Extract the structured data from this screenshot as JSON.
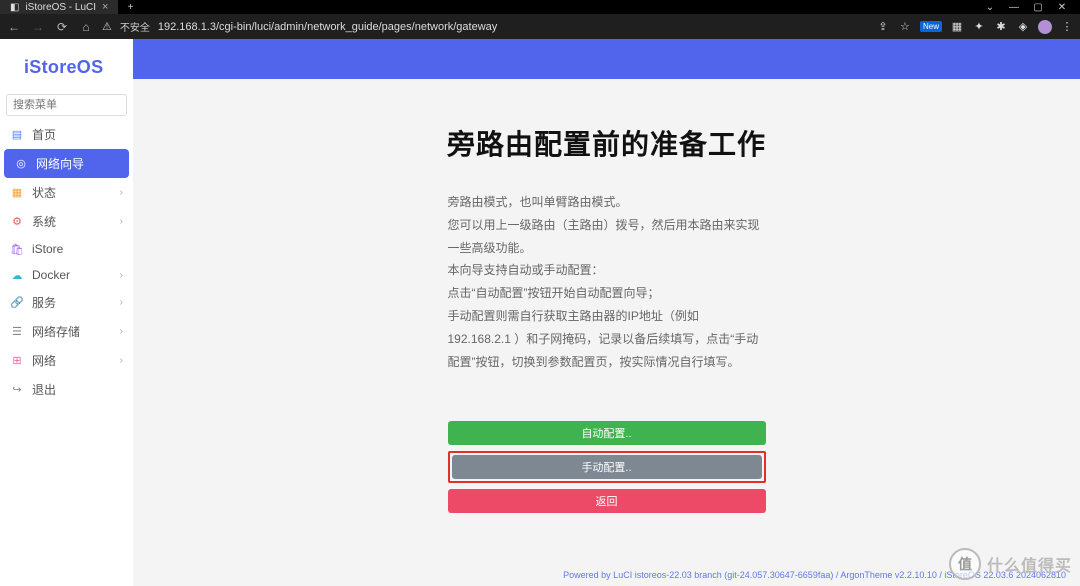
{
  "browser": {
    "tab_title": "iStoreOS - LuCI",
    "insecure_label": "不安全",
    "url": "192.168.1.3/cgi-bin/luci/admin/network_guide/pages/network/gateway",
    "new_badge": "New"
  },
  "logo": "iStoreOS",
  "search": {
    "placeholder": "搜索菜单"
  },
  "menu": {
    "items": [
      {
        "label": "首页",
        "icon": "home-icon"
      },
      {
        "label": "网络向导",
        "icon": "compass-icon"
      },
      {
        "label": "状态",
        "icon": "grid-icon"
      },
      {
        "label": "系统",
        "icon": "gear-icon"
      },
      {
        "label": "iStore",
        "icon": "bag-icon"
      },
      {
        "label": "Docker",
        "icon": "cloud-icon"
      },
      {
        "label": "服务",
        "icon": "link-icon"
      },
      {
        "label": "网络存储",
        "icon": "list-icon"
      },
      {
        "label": "网络",
        "icon": "network-icon"
      },
      {
        "label": "退出",
        "icon": "logout-icon"
      }
    ]
  },
  "page": {
    "title": "旁路由配置前的准备工作",
    "desc_lines": [
      "旁路由模式，也叫单臂路由模式。",
      "您可以用上一级路由（主路由）拨号，然后用本路由来实现一些高级功能。",
      "本向导支持自动或手动配置：",
      "点击“自动配置”按钮开始自动配置向导；",
      "手动配置则需自行获取主路由器的IP地址（例如 192.168.2.1 ）和子网掩码，记录以备后续填写，点击“手动配置”按钮，切换到参数配置页，按实际情况自行填写。"
    ],
    "btn_auto": "自动配置..",
    "btn_manual": "手动配置..",
    "btn_back": "返回"
  },
  "footer": {
    "text": "Powered by LuCI istoreos-22.03 branch (git-24.057.30647-6659faa) / ArgonTheme v2.2.10.10 / iStoreOS 22.03.6 2024062810"
  },
  "watermark": {
    "badge": "值",
    "text": "什么值得买"
  }
}
